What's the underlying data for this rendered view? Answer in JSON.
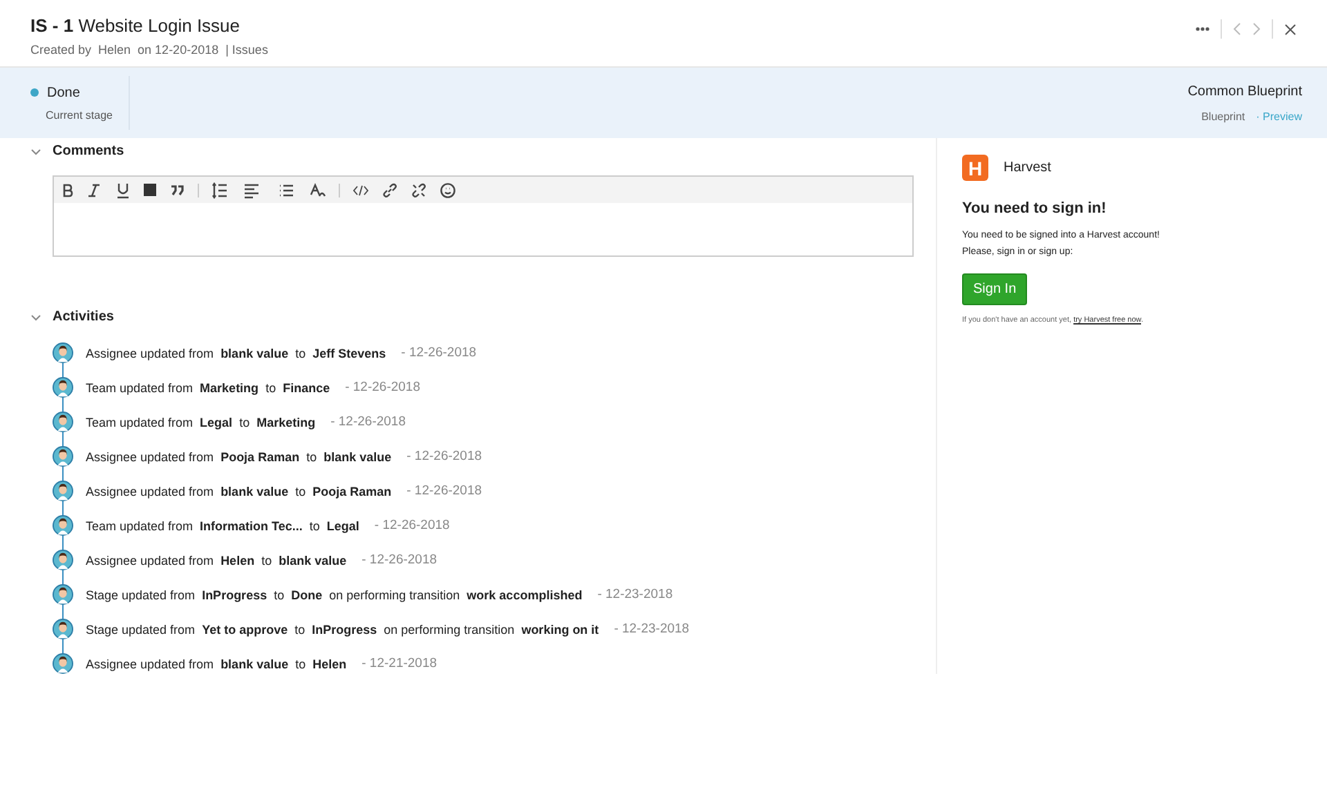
{
  "header": {
    "title": "**IS - 1** Website Login Issue",
    "subtitle": "Created by  Helen  on 12-20-2018  | Issues"
  },
  "stage": {
    "name": "Done",
    "color": "#3ea6c7",
    "caption": "Current stage",
    "blueprint_title": "Common Blueprint",
    "blueprint_label": "Blueprint",
    "preview_link": "· Preview"
  },
  "comments": {
    "title": "Comments",
    "expanded": true
  },
  "activities": {
    "title": "Activities",
    "expanded": true,
    "items": [
      {
        "text": "Assignee updated from  **blank value**  to  **Jeff Stevens**",
        "date": "- 12-26-2018"
      },
      {
        "text": "Team updated from  **Marketing**  to  **Finance**",
        "date": "- 12-26-2018"
      },
      {
        "text": "Team updated from  **Legal**  to  **Marketing**",
        "date": "- 12-26-2018"
      },
      {
        "text": "Assignee updated from  **Pooja Raman**  to  **blank value**",
        "date": "- 12-26-2018"
      },
      {
        "text": "Assignee updated from  **blank value**  to  **Pooja Raman**",
        "date": "- 12-26-2018"
      },
      {
        "text": "Team updated from  **Information Tec...**  to  **Legal**",
        "date": "- 12-26-2018"
      },
      {
        "text": "Assignee updated from  **Helen**  to  **blank value**",
        "date": "- 12-26-2018"
      },
      {
        "text": "Stage updated from  **InProgress**  to  **Done**  on performing transition  **work accomplished**",
        "date": "- 12-23-2018"
      },
      {
        "text": "Stage updated from  **Yet to approve**  to  **InProgress**  on performing transition  **working on it**",
        "date": "- 12-23-2018"
      },
      {
        "text": "Assignee updated from  **blank value**  to  **Helen**",
        "date": "- 12-21-2018"
      }
    ]
  },
  "harvest": {
    "logo_letter": "H",
    "name": "Harvest",
    "heading": "You need to sign in!",
    "message": "You need to be signed into a Harvest account!\nPlease, sign in or sign up:",
    "button": "Sign In",
    "footer": "If you don't have an account yet,",
    "footer_link": "try Harvest free now",
    "footer_end": "."
  }
}
